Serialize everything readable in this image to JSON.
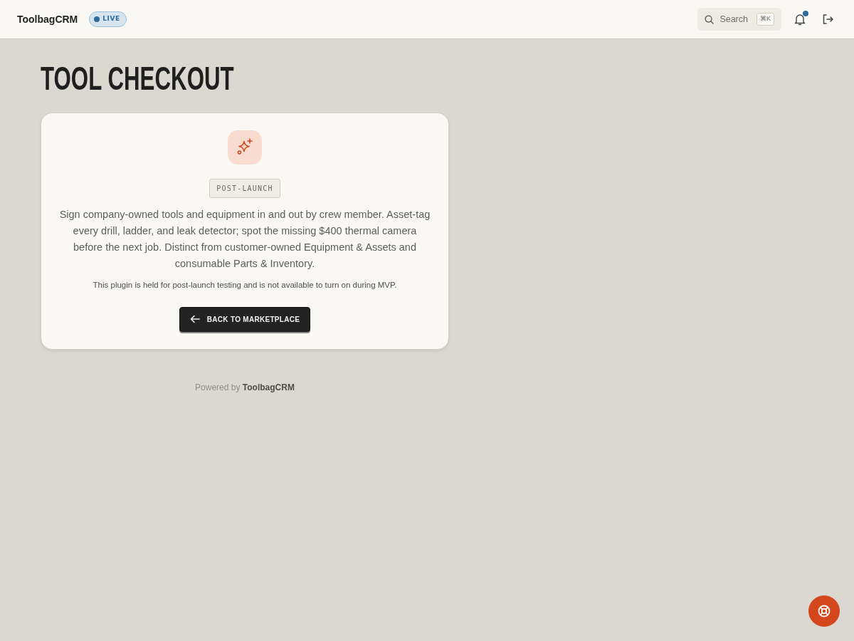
{
  "header": {
    "brand": "ToolbagCRM",
    "status_badge": "LIVE",
    "search": {
      "label": "Search",
      "shortcut": "⌘K"
    },
    "notifications": {
      "unread": true
    }
  },
  "page_title": "TOOL CHECKOUT",
  "plugin_card": {
    "badge": "POST-LAUNCH",
    "description": "Sign company-owned tools and equipment in and out by crew member. Asset-tag every drill, ladder, and leak detector; spot the missing $400 thermal camera before the next job. Distinct from customer-owned Equipment & Assets and consumable Parts & Inventory.",
    "note": "This plugin is held for post-launch testing and is not available to turn on during MVP.",
    "back_button": "BACK TO MARKETPLACE"
  },
  "footer": "Powered by **ToolbagCRM**"
}
